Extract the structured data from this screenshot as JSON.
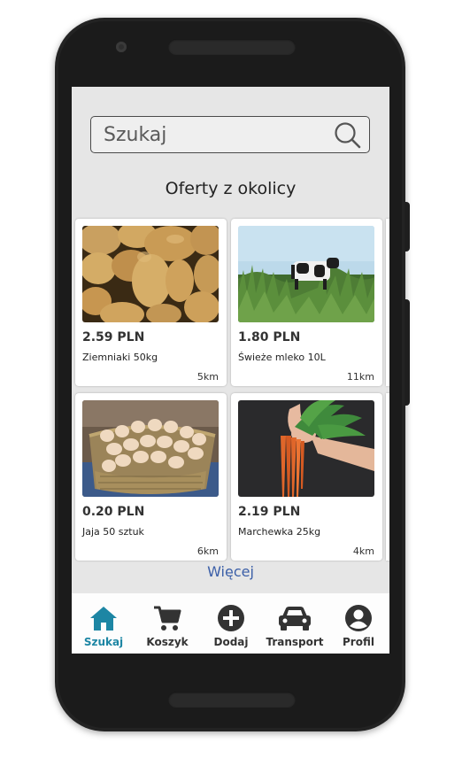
{
  "search": {
    "placeholder": "Szukaj"
  },
  "section_title": "Oferty z okolicy",
  "offers": [
    {
      "price": "2.59 PLN",
      "name": "Ziemniaki 50kg",
      "distance": "5km",
      "image": "potatoes"
    },
    {
      "price": "1.80 PLN",
      "name": "Świeże mleko 10L",
      "distance": "11km",
      "image": "cow-in-field"
    },
    {
      "price": "0.20 PLN",
      "name": "Jaja 50 sztuk",
      "distance": "6km",
      "image": "eggs-basket"
    },
    {
      "price": "2.19 PLN",
      "name": "Marchewka 25kg",
      "distance": "4km",
      "image": "carrots"
    }
  ],
  "more_label": "Więcej",
  "nav": {
    "items": [
      {
        "label": "Szukaj",
        "icon": "home-icon",
        "active": true
      },
      {
        "label": "Koszyk",
        "icon": "cart-icon",
        "active": false
      },
      {
        "label": "Dodaj",
        "icon": "add-icon",
        "active": false
      },
      {
        "label": "Transport",
        "icon": "car-icon",
        "active": false
      },
      {
        "label": "Profil",
        "icon": "profile-icon",
        "active": false
      }
    ]
  },
  "colors": {
    "accent": "#1d86a4",
    "link": "#3b5fa8",
    "screen_bg": "#e6e6e6"
  }
}
